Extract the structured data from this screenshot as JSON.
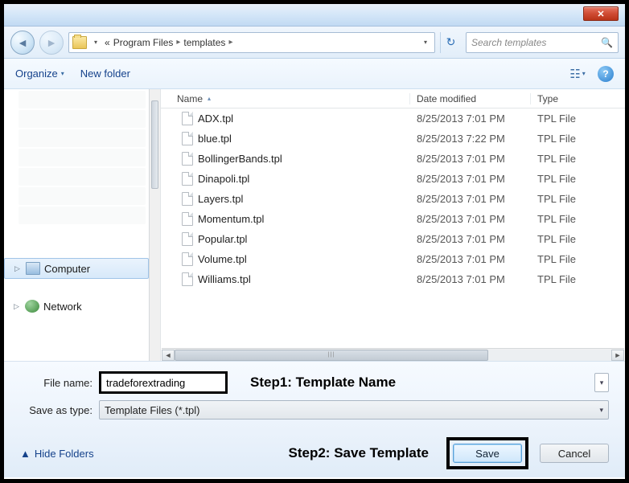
{
  "titlebar": {
    "close_glyph": "✕"
  },
  "nav": {
    "back_glyph": "◄",
    "fwd_glyph": "►",
    "refresh_glyph": "↻",
    "crumb_lead": "«",
    "crumb1": "Program Files",
    "crumb2": "templates",
    "crumb_sep": "▸",
    "crumb_drop": "▾",
    "search_placeholder": "Search templates",
    "search_glyph": "🔍"
  },
  "toolbar": {
    "organize_label": "Organize",
    "newfolder_label": "New folder",
    "drop_glyph": "▾",
    "view_glyph": "☷",
    "help_glyph": "?"
  },
  "sidebar": {
    "computer_label": "Computer",
    "network_label": "Network",
    "expand_glyph": "▷"
  },
  "columns": {
    "name": "Name",
    "date": "Date modified",
    "type": "Type",
    "sort_glyph": "▴"
  },
  "files": [
    {
      "name": "ADX.tpl",
      "date": "8/25/2013 7:01 PM",
      "type": "TPL File"
    },
    {
      "name": "blue.tpl",
      "date": "8/25/2013 7:22 PM",
      "type": "TPL File"
    },
    {
      "name": "BollingerBands.tpl",
      "date": "8/25/2013 7:01 PM",
      "type": "TPL File"
    },
    {
      "name": "Dinapoli.tpl",
      "date": "8/25/2013 7:01 PM",
      "type": "TPL File"
    },
    {
      "name": "Layers.tpl",
      "date": "8/25/2013 7:01 PM",
      "type": "TPL File"
    },
    {
      "name": "Momentum.tpl",
      "date": "8/25/2013 7:01 PM",
      "type": "TPL File"
    },
    {
      "name": "Popular.tpl",
      "date": "8/25/2013 7:01 PM",
      "type": "TPL File"
    },
    {
      "name": "Volume.tpl",
      "date": "8/25/2013 7:01 PM",
      "type": "TPL File"
    },
    {
      "name": "Williams.tpl",
      "date": "8/25/2013 7:01 PM",
      "type": "TPL File"
    }
  ],
  "hscroll": {
    "left": "◄",
    "right": "►",
    "grip": "|||"
  },
  "form": {
    "filename_label": "File name:",
    "filename_value": "tradeforextrading",
    "saveas_label": "Save as type:",
    "saveas_value": "Template Files (*.tpl)",
    "step1": "Step1: Template Name",
    "step2": "Step2: Save Template",
    "drop_glyph": "▾"
  },
  "actions": {
    "hide_folders": "Hide Folders",
    "hide_glyph": "▲",
    "save": "Save",
    "cancel": "Cancel"
  }
}
